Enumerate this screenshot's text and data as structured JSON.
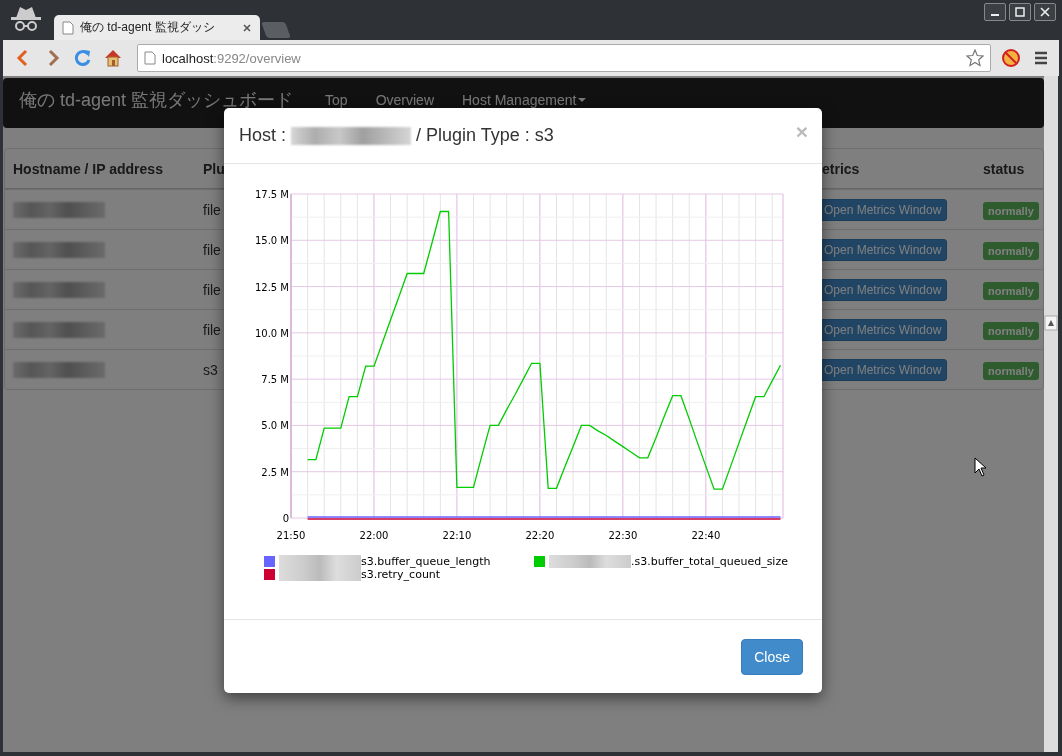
{
  "browser": {
    "tab_title": "俺の td-agent 監視ダッシ",
    "address": {
      "host": "localhost",
      "path": ":9292/overview"
    }
  },
  "navbar": {
    "brand": "俺の td-agent 監視ダッシュボード",
    "links": [
      {
        "label": "Top",
        "dropdown": false
      },
      {
        "label": "Overview",
        "dropdown": false
      },
      {
        "label": "Host Management",
        "dropdown": true
      }
    ]
  },
  "table": {
    "columns": [
      "Hostname / IP address",
      "Plu",
      "etrics",
      "status"
    ],
    "rows": [
      {
        "plugin": "file",
        "metrics_button": "Open Metrics Window",
        "status": "normally"
      },
      {
        "plugin": "file",
        "metrics_button": "Open Metrics Window",
        "status": "normally"
      },
      {
        "plugin": "file",
        "metrics_button": "Open Metrics Window",
        "status": "normally"
      },
      {
        "plugin": "file",
        "metrics_button": "Open Metrics Window",
        "status": "normally"
      },
      {
        "plugin": "s3",
        "metrics_button": "Open Metrics Window",
        "status": "normally"
      }
    ]
  },
  "modal": {
    "title_prefix": "Host :",
    "title_suffix": "/ Plugin Type : s3",
    "close_symbol": "×",
    "close_button": "Close",
    "chart_data": {
      "type": "line",
      "ylim": [
        0,
        17.5
      ],
      "grid": true,
      "categories": [
        "21:50",
        null,
        null,
        null,
        null,
        null,
        null,
        null,
        null,
        null,
        "22:00",
        null,
        null,
        null,
        null,
        null,
        null,
        null,
        null,
        null,
        "22:10",
        null,
        null,
        null,
        null,
        null,
        null,
        null,
        null,
        null,
        "22:20",
        null,
        null,
        null,
        null,
        null,
        null,
        null,
        null,
        null,
        "22:30",
        null,
        null,
        null,
        null,
        null,
        null,
        null,
        null,
        null,
        "22:40",
        null,
        null,
        null,
        null,
        null,
        null,
        null,
        null,
        null
      ],
      "yticks": [
        {
          "value": 0,
          "label": "0"
        },
        {
          "value": 2.5,
          "label": "2.5 M"
        },
        {
          "value": 5,
          "label": "5.0 M"
        },
        {
          "value": 7.5,
          "label": "7.5 M"
        },
        {
          "value": 10,
          "label": "10.0 M"
        },
        {
          "value": 12.5,
          "label": "12.5 M"
        },
        {
          "value": 15,
          "label": "15.0 M"
        },
        {
          "value": 17.5,
          "label": "17.5 M"
        }
      ],
      "series": [
        {
          "name": "s3.buffer_queue_length",
          "color": "#6666ff",
          "values": [
            null,
            null,
            0,
            0,
            0,
            0,
            0,
            0,
            0,
            0,
            0,
            0,
            0,
            0,
            0,
            0,
            0,
            0,
            0,
            0,
            0,
            0,
            0,
            0,
            0,
            0,
            0,
            0,
            0,
            0,
            0,
            0,
            0,
            0,
            0,
            0,
            0,
            0,
            0,
            0,
            0,
            0,
            0,
            0,
            0,
            0,
            0,
            0,
            0,
            0,
            0,
            0,
            0,
            0,
            0,
            0,
            0,
            0,
            0,
            0
          ]
        },
        {
          "name": "s3.retry_count",
          "color": "#cc0033",
          "values": [
            null,
            null,
            0,
            0,
            0,
            0,
            0,
            0,
            0,
            0,
            0,
            0,
            0,
            0,
            0,
            0,
            0,
            0,
            0,
            0,
            0,
            0,
            0,
            0,
            0,
            0,
            0,
            0,
            0,
            0,
            0,
            0,
            0,
            0,
            0,
            0,
            0,
            0,
            0,
            0,
            0,
            0,
            0,
            0,
            0,
            0,
            0,
            0,
            0,
            0,
            0,
            0,
            0,
            0,
            0,
            0,
            0,
            0,
            0,
            0
          ]
        },
        {
          "name": ".s3.buffer_total_queued_size",
          "color": "#00cc00",
          "values": [
            null,
            null,
            3.1,
            3.1,
            4.8,
            4.8,
            4.8,
            6.5,
            6.5,
            8.15,
            8.15,
            9.4,
            10.65,
            11.9,
            13.15,
            13.15,
            13.15,
            14.8,
            16.5,
            16.5,
            1.6,
            1.6,
            1.6,
            3.3,
            4.95,
            4.95,
            5.8,
            6.6,
            7.45,
            8.3,
            8.3,
            1.55,
            1.55,
            2.7,
            3.8,
            4.95,
            4.95,
            4.65,
            4.4,
            4.1,
            3.8,
            3.5,
            3.2,
            3.2,
            4.3,
            5.45,
            6.55,
            6.55,
            5.3,
            4.0,
            2.75,
            1.5,
            1.5,
            2.75,
            4.0,
            5.25,
            6.5,
            6.5,
            7.35,
            8.2
          ]
        }
      ]
    }
  }
}
